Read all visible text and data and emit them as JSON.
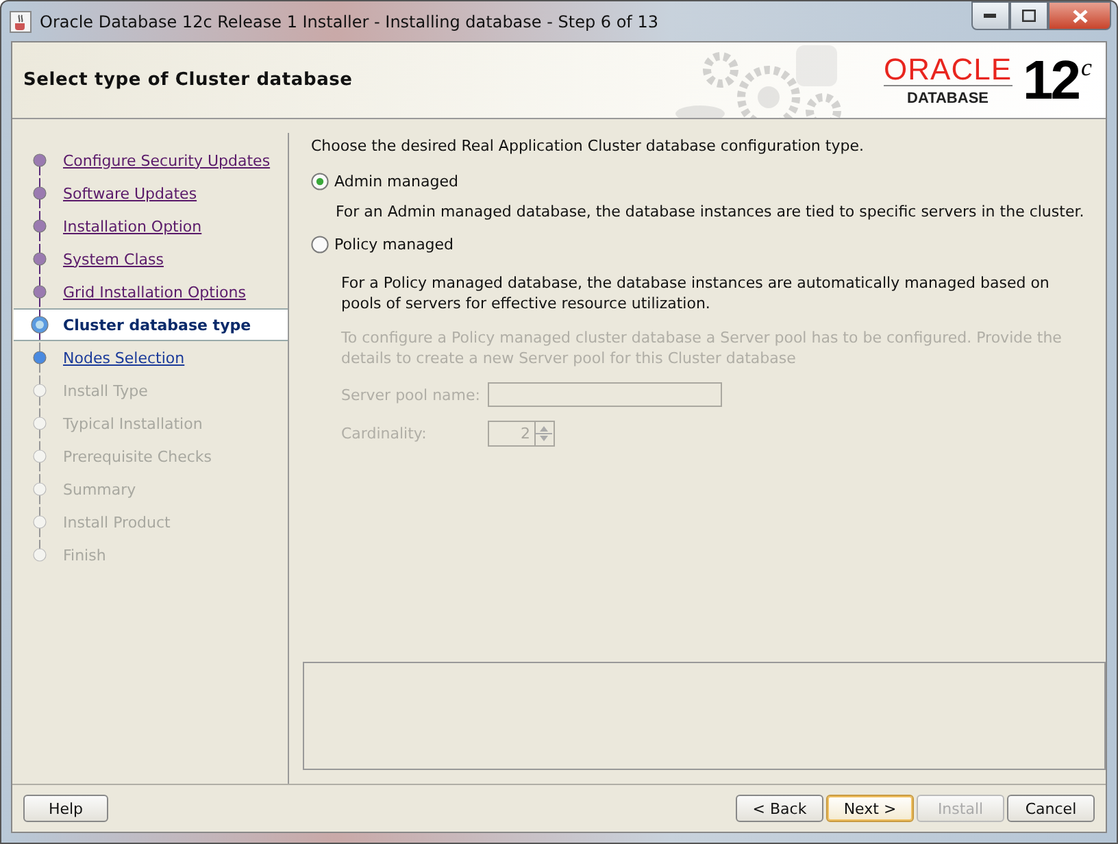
{
  "window": {
    "title": "Oracle Database 12c Release 1 Installer - Installing database - Step 6 of 13"
  },
  "header": {
    "title": "Select type of Cluster database",
    "logo_brand": "ORACLE",
    "logo_product": "DATABASE",
    "logo_version": "12",
    "logo_suffix": "c"
  },
  "steps": [
    {
      "label": "Configure Security Updates",
      "visited": true,
      "selected": false,
      "disabled": false
    },
    {
      "label": "Software Updates",
      "visited": true,
      "selected": false,
      "disabled": false
    },
    {
      "label": "Installation Option",
      "visited": true,
      "selected": false,
      "disabled": false
    },
    {
      "label": "System Class",
      "visited": true,
      "selected": false,
      "disabled": false
    },
    {
      "label": "Grid Installation Options",
      "visited": true,
      "selected": false,
      "disabled": false
    },
    {
      "label": "Cluster database type",
      "visited": false,
      "selected": true,
      "disabled": false
    },
    {
      "label": "Nodes Selection",
      "visited": false,
      "selected": false,
      "disabled": false
    },
    {
      "label": "Install Type",
      "visited": false,
      "selected": false,
      "disabled": true
    },
    {
      "label": "Typical Installation",
      "visited": false,
      "selected": false,
      "disabled": true
    },
    {
      "label": "Prerequisite Checks",
      "visited": false,
      "selected": false,
      "disabled": true
    },
    {
      "label": "Summary",
      "visited": false,
      "selected": false,
      "disabled": true
    },
    {
      "label": "Install Product",
      "visited": false,
      "selected": false,
      "disabled": true
    },
    {
      "label": "Finish",
      "visited": false,
      "selected": false,
      "disabled": true
    }
  ],
  "content": {
    "intro": "Choose the desired Real Application Cluster database configuration type.",
    "options": [
      {
        "label": "Admin managed",
        "selected": true,
        "description": "For an Admin managed database, the database instances are tied to specific servers in the cluster."
      },
      {
        "label": "Policy managed",
        "selected": false,
        "description": "For a Policy managed database, the database instances are automatically managed based on pools of servers for effective resource utilization."
      }
    ],
    "pool_note": "To configure a Policy managed cluster database a Server pool has to be configured. Provide the details to create a new Server pool for this Cluster database",
    "fields": [
      {
        "kind": "text",
        "label": "Server pool name:",
        "disabled": true
      },
      {
        "kind": "spinner",
        "label": "Cardinality:",
        "value": "2",
        "disabled": true
      }
    ]
  },
  "buttons_left": [
    {
      "label": "Help",
      "disabled": false,
      "default": false
    }
  ],
  "buttons_right": [
    {
      "label": "< Back",
      "disabled": false,
      "default": false
    },
    {
      "label": "Next >",
      "disabled": false,
      "default": true
    },
    {
      "label": "Install",
      "disabled": true,
      "default": false
    },
    {
      "label": "Cancel",
      "disabled": false,
      "default": false
    }
  ]
}
